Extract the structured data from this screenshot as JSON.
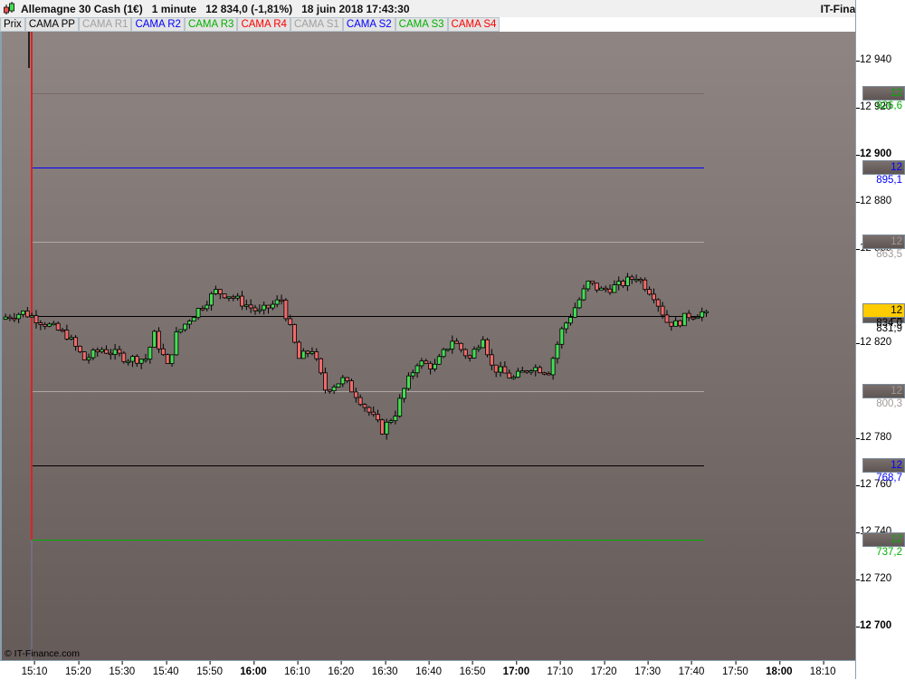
{
  "header": {
    "title": "Allemagne 30 Cash (1€)   1 minute   12 834,0 (-1,81%)   18 juin 2018 17:43:30",
    "site": "IT-Finance.com"
  },
  "tabs": [
    {
      "label": "Prix",
      "color": "#000000"
    },
    {
      "label": "CAMA PP",
      "color": "#000000"
    },
    {
      "label": "CAMA R1",
      "color": "#a0a0a0"
    },
    {
      "label": "CAMA R2",
      "color": "#0000ff"
    },
    {
      "label": "CAMA R3",
      "color": "#00b000"
    },
    {
      "label": "CAMA R4",
      "color": "#ff0000"
    },
    {
      "label": "CAMA S1",
      "color": "#a0a0a0"
    },
    {
      "label": "CAMA S2",
      "color": "#0000ff"
    },
    {
      "label": "CAMA S3",
      "color": "#00b000"
    },
    {
      "label": "CAMA S4",
      "color": "#ff0000"
    }
  ],
  "copyright": "© IT-Finance.com",
  "chart_data": {
    "type": "candlestick",
    "interval": "1 minute",
    "ylim": [
      12688,
      12965
    ],
    "y_ticks": [
      {
        "v": 12940,
        "label": "12 940"
      },
      {
        "v": 12920,
        "label": "12 920"
      },
      {
        "v": 12900,
        "label": "12 900",
        "bold": true
      },
      {
        "v": 12880,
        "label": "12 880"
      },
      {
        "v": 12860,
        "label": "12 860"
      },
      {
        "v": 12820,
        "label": "12 820"
      },
      {
        "v": 12780,
        "label": "12 780"
      },
      {
        "v": 12760,
        "label": "12 760"
      },
      {
        "v": 12740,
        "label": "12 740"
      },
      {
        "v": 12720,
        "label": "12 720"
      },
      {
        "v": 12700,
        "label": "12 700",
        "bold": true
      }
    ],
    "x_ticks": [
      {
        "t": "15:10"
      },
      {
        "t": "15:20"
      },
      {
        "t": "15:30"
      },
      {
        "t": "15:40"
      },
      {
        "t": "15:50"
      },
      {
        "t": "16:00",
        "bold": true
      },
      {
        "t": "16:10"
      },
      {
        "t": "16:20"
      },
      {
        "t": "16:30"
      },
      {
        "t": "16:40"
      },
      {
        "t": "16:50"
      },
      {
        "t": "17:00",
        "bold": true
      },
      {
        "t": "17:10"
      },
      {
        "t": "17:20"
      },
      {
        "t": "17:30"
      },
      {
        "t": "17:40"
      },
      {
        "t": "17:50"
      },
      {
        "t": "18:00",
        "bold": true
      },
      {
        "t": "18:10"
      }
    ],
    "levels": [
      {
        "value": 12926.6,
        "label": "12 926,6",
        "line_color": "#7a6a68",
        "label_color": "#00b000"
      },
      {
        "value": 12895.1,
        "label": "12 895,1",
        "line_color": "#0000ff",
        "label_color": "#0000ff"
      },
      {
        "value": 12863.5,
        "label": "12 863,5",
        "line_color": "#b0a8a6",
        "label_color": "#a09896"
      },
      {
        "value": 12831.9,
        "label": "12 831,9",
        "line_color": "#000000",
        "label_color": "#000000"
      },
      {
        "value": 12800.3,
        "label": "12 800,3",
        "line_color": "#b0a8a6",
        "label_color": "#a09896"
      },
      {
        "value": 12768.7,
        "label": "12 768,7",
        "line_color": "#000000",
        "label_color": "#0000ff"
      },
      {
        "value": 12737.2,
        "label": "12 737,2",
        "line_color": "#00b000",
        "label_color": "#00b000"
      }
    ],
    "last_price": {
      "value": 12834.0,
      "label": "12 834,0",
      "color": "#ffcc00"
    },
    "price_path": [
      [
        "15:03",
        12831.7
      ],
      [
        "15:07",
        12833.6
      ],
      [
        "15:09",
        12832
      ],
      [
        "15:13",
        12828
      ],
      [
        "15:17",
        12824
      ],
      [
        "15:21",
        12813.7
      ],
      [
        "15:25",
        12818
      ],
      [
        "15:31",
        12814
      ],
      [
        "15:35",
        12814
      ],
      [
        "15:37",
        12824
      ],
      [
        "15:40",
        12810.6
      ],
      [
        "15:42",
        12824
      ],
      [
        "15:45",
        12831
      ],
      [
        "15:51",
        12842.5
      ],
      [
        "15:54",
        12841
      ],
      [
        "16:01",
        12833.6
      ],
      [
        "16:06",
        12839
      ],
      [
        "16:10",
        12814
      ],
      [
        "16:13",
        12818
      ],
      [
        "16:16",
        12801
      ],
      [
        "16:20",
        12805
      ],
      [
        "16:23",
        12799
      ],
      [
        "16:29",
        12783.7
      ],
      [
        "16:32",
        12791
      ],
      [
        "16:34",
        12801
      ],
      [
        "16:37",
        12812.5
      ],
      [
        "16:41",
        12810.6
      ],
      [
        "16:45",
        12822
      ],
      [
        "16:49",
        12814
      ],
      [
        "16:52",
        12824
      ],
      [
        "16:54",
        12810.6
      ],
      [
        "16:59",
        12805.6
      ],
      [
        "17:03",
        12810.6
      ],
      [
        "17:07",
        12808.7
      ],
      [
        "17:10",
        12826
      ],
      [
        "17:14",
        12839
      ],
      [
        "17:16",
        12846
      ],
      [
        "17:19",
        12843
      ],
      [
        "17:23",
        12845
      ],
      [
        "17:27",
        12849
      ],
      [
        "17:31",
        12841
      ],
      [
        "17:34",
        12829.8
      ],
      [
        "17:36",
        12828.6
      ],
      [
        "17:39",
        12832.5
      ],
      [
        "17:43",
        12834.0
      ]
    ],
    "up_color": "#44dd55",
    "down_color": "#ee6a6a"
  }
}
